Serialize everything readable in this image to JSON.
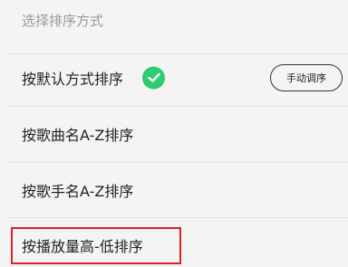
{
  "header": {
    "title": "选择排序方式"
  },
  "options": [
    {
      "label": "按默认方式排序",
      "selected": true,
      "action_label": "手动调序"
    },
    {
      "label": "按歌曲名A-Z排序",
      "selected": false
    },
    {
      "label": "按歌手名A-Z排序",
      "selected": false
    },
    {
      "label": "按播放量高-低排序",
      "selected": false,
      "highlighted": true
    }
  ],
  "colors": {
    "check": "#2ecc71",
    "highlight": "#e02020"
  },
  "icons": {
    "selected": "checkmark-icon"
  }
}
